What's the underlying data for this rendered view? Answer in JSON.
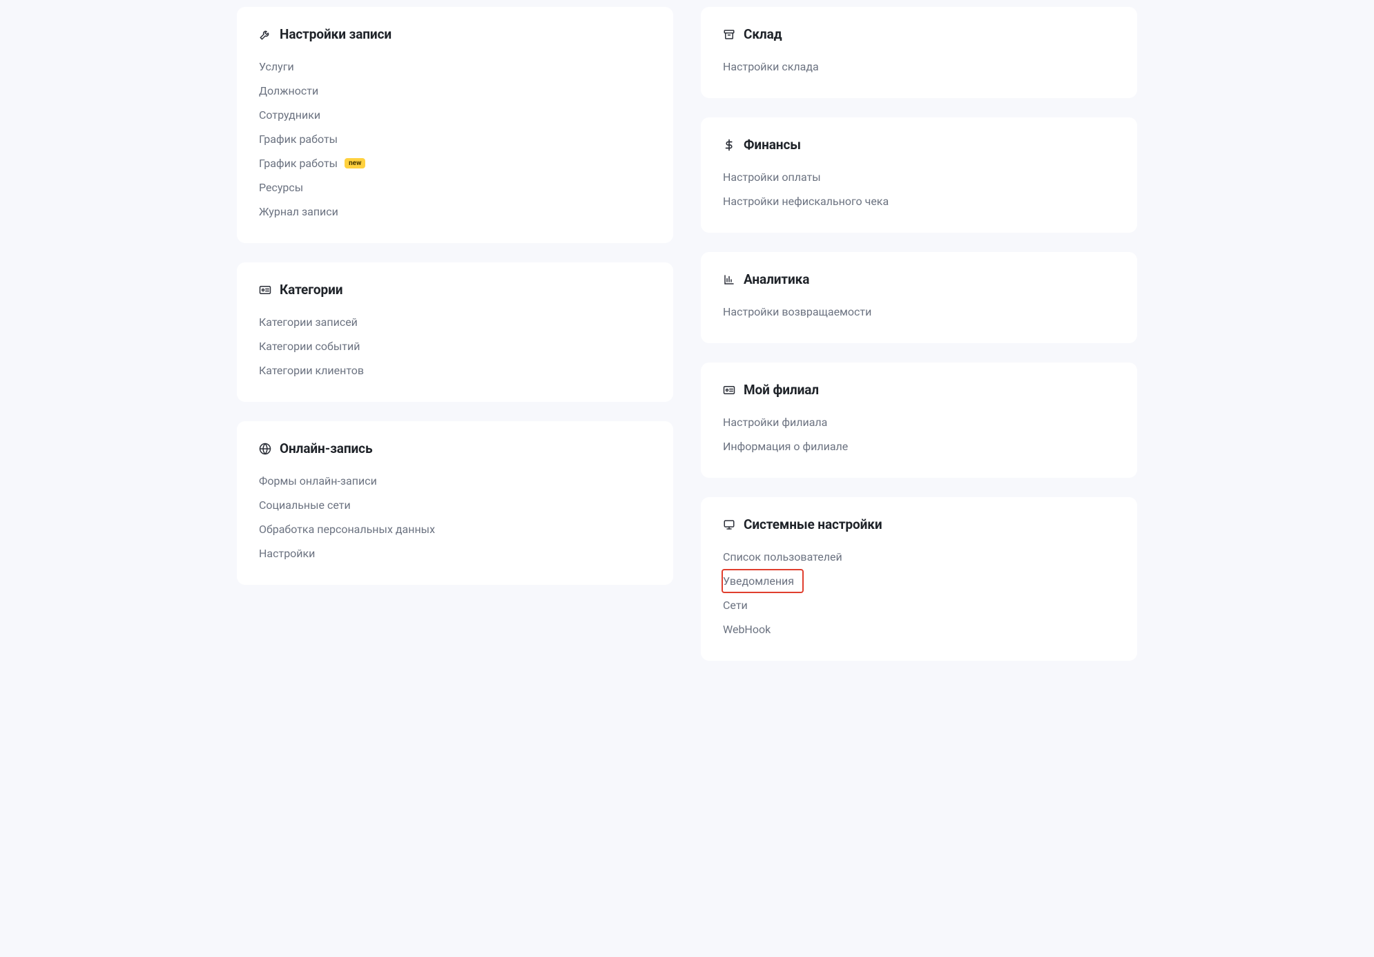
{
  "left_cards": [
    {
      "id": "booking-settings",
      "icon": "wrench-icon",
      "title": "Настройки записи",
      "items": [
        {
          "label": "Услуги",
          "highlighted": false,
          "badge": null
        },
        {
          "label": "Должности",
          "highlighted": false,
          "badge": null
        },
        {
          "label": "Сотрудники",
          "highlighted": false,
          "badge": null
        },
        {
          "label": "График работы",
          "highlighted": false,
          "badge": null
        },
        {
          "label": "График работы",
          "highlighted": false,
          "badge": "new"
        },
        {
          "label": "Ресурсы",
          "highlighted": false,
          "badge": null
        },
        {
          "label": "Журнал записи",
          "highlighted": false,
          "badge": null
        }
      ]
    },
    {
      "id": "categories",
      "icon": "card-icon",
      "title": "Категории",
      "items": [
        {
          "label": "Категории записей",
          "highlighted": false,
          "badge": null
        },
        {
          "label": "Категории событий",
          "highlighted": false,
          "badge": null
        },
        {
          "label": "Категории клиентов",
          "highlighted": false,
          "badge": null
        }
      ]
    },
    {
      "id": "online-booking",
      "icon": "globe-icon",
      "title": "Онлайн-запись",
      "items": [
        {
          "label": "Формы онлайн-записи",
          "highlighted": false,
          "badge": null
        },
        {
          "label": "Социальные сети",
          "highlighted": false,
          "badge": null
        },
        {
          "label": "Обработка персональных данных",
          "highlighted": false,
          "badge": null
        },
        {
          "label": "Настройки",
          "highlighted": false,
          "badge": null
        }
      ]
    }
  ],
  "right_cards": [
    {
      "id": "warehouse",
      "icon": "archive-icon",
      "title": "Склад",
      "items": [
        {
          "label": "Настройки склада",
          "highlighted": false,
          "badge": null
        }
      ]
    },
    {
      "id": "finance",
      "icon": "dollar-icon",
      "title": "Финансы",
      "items": [
        {
          "label": "Настройки оплаты",
          "highlighted": false,
          "badge": null
        },
        {
          "label": "Настройки нефискального чека",
          "highlighted": false,
          "badge": null
        }
      ]
    },
    {
      "id": "analytics",
      "icon": "chart-icon",
      "title": "Аналитика",
      "items": [
        {
          "label": "Настройки возвращаемости",
          "highlighted": false,
          "badge": null
        }
      ]
    },
    {
      "id": "my-branch",
      "icon": "card-icon",
      "title": "Мой филиал",
      "items": [
        {
          "label": "Настройки филиала",
          "highlighted": false,
          "badge": null
        },
        {
          "label": "Информация о филиале",
          "highlighted": false,
          "badge": null
        }
      ]
    },
    {
      "id": "system-settings",
      "icon": "monitor-icon",
      "title": "Системные настройки",
      "items": [
        {
          "label": "Список пользователей",
          "highlighted": false,
          "badge": null
        },
        {
          "label": "Уведомления",
          "highlighted": true,
          "badge": null
        },
        {
          "label": "Сети",
          "highlighted": false,
          "badge": null
        },
        {
          "label": "WebHook",
          "highlighted": false,
          "badge": null
        }
      ]
    }
  ],
  "badge_text": "new"
}
